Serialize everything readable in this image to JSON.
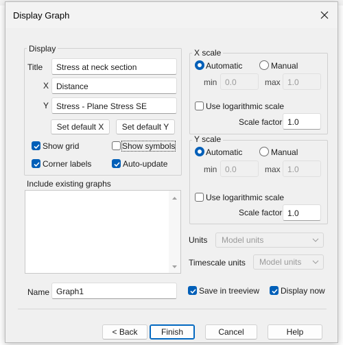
{
  "window": {
    "title": "Display Graph",
    "close_label": "×"
  },
  "display": {
    "group_label": "Display",
    "title_label": "Title",
    "title_value": "Stress at neck section",
    "x_label": "X",
    "x_value": "Distance",
    "y_label": "Y",
    "y_value": "Stress - Plane Stress SE",
    "set_default_x": "Set default X",
    "set_default_y": "Set default Y",
    "show_grid": "Show grid",
    "show_symbols": "Show symbols",
    "corner_labels": "Corner labels",
    "auto_update": "Auto-update"
  },
  "x_scale": {
    "group_label": "X scale",
    "automatic": "Automatic",
    "manual": "Manual",
    "min_label": "min",
    "min_value": "0.0",
    "max_label": "max",
    "max_value": "1.0",
    "log_label": "Use logarithmic scale",
    "scale_factor_label": "Scale factor",
    "scale_factor_value": "1.0"
  },
  "y_scale": {
    "group_label": "Y scale",
    "automatic": "Automatic",
    "manual": "Manual",
    "min_label": "min",
    "min_value": "0.0",
    "max_label": "max",
    "max_value": "1.0",
    "log_label": "Use logarithmic scale",
    "scale_factor_label": "Scale factor",
    "scale_factor_value": "1.0"
  },
  "existing": {
    "label": "Include existing graphs"
  },
  "units": {
    "label": "Units",
    "value": "Model units"
  },
  "timescale": {
    "label": "Timescale units",
    "value": "Model units"
  },
  "name": {
    "label": "Name",
    "value": "Graph1"
  },
  "options": {
    "save_in_treeview": "Save in treeview",
    "display_now": "Display now"
  },
  "buttons": {
    "back": "< Back",
    "finish": "Finish",
    "cancel": "Cancel",
    "help": "Help"
  },
  "colors": {
    "accent": "#005fb8"
  }
}
